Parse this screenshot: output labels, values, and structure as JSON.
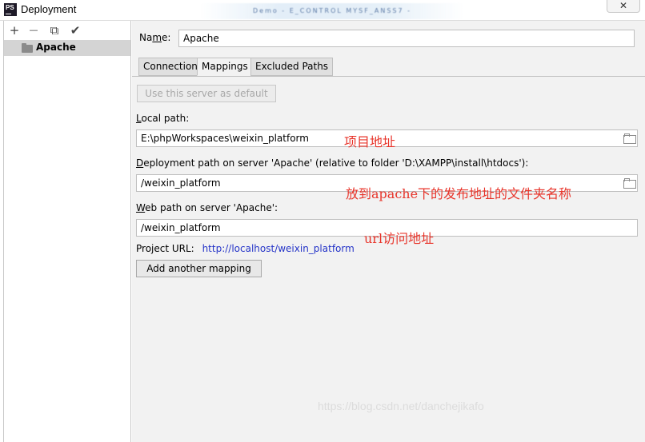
{
  "window": {
    "title": "Deployment",
    "app_icon_text": "PS",
    "close_glyph": "✕",
    "blurred_header_text": "Demo - E_CONTROL MYSF_ANSS7 -"
  },
  "toolbar": {
    "add_glyph": "+",
    "remove_glyph": "—",
    "copy_glyph": "⧉",
    "check_glyph": "✔",
    "icons": [
      "plus-icon",
      "minus-icon",
      "copy-icon",
      "check-icon"
    ]
  },
  "tree": {
    "items": [
      {
        "label": "Apache",
        "icon": "folder-icon"
      }
    ]
  },
  "form": {
    "name_label_pre": "Na",
    "name_label_mn": "m",
    "name_label_post": "e:",
    "name_value": "Apache",
    "tabs": [
      {
        "label": "Connection"
      },
      {
        "label": "Mappings",
        "active": true
      },
      {
        "label": "Excluded Paths"
      }
    ],
    "use_default_button": "Use this server as default",
    "local_path_label_mn": "L",
    "local_path_label_rest": "ocal path:",
    "local_path_value": "E:\\phpWorkspaces\\weixin_platform",
    "deployment_path_label_mn": "D",
    "deployment_path_label_rest": "eployment path on server 'Apache' (relative to folder 'D:\\XAMPP\\install\\htdocs'):",
    "deployment_path_value": "/weixin_platform",
    "web_path_label_mn": "W",
    "web_path_label_rest": "eb path on server 'Apache':",
    "web_path_value": "/weixin_platform",
    "project_url_label": "Project URL:",
    "project_url_value": "http://localhost/weixin_platform",
    "add_mapping_button": "Add another mapping"
  },
  "annotations": {
    "local_path_note": "项目地址",
    "deployment_path_note": "放到apache下的发布地址的文件夹名称",
    "web_path_note": "url访问地址"
  },
  "watermark": "https://blog.csdn.net/danchejikafo",
  "colors": {
    "annotation": "#e8352b",
    "link": "#2534c8",
    "selection": "#d4d4d4"
  }
}
